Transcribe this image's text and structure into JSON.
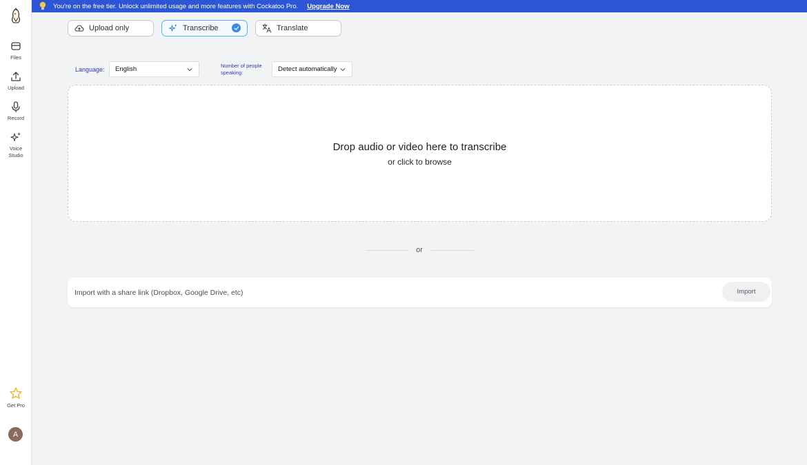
{
  "banner": {
    "icon": "lightbulb-icon",
    "text": "You're on the free tier. Unlock unlimited usage and more features with Cockatoo Pro.",
    "link": "Upgrade Now"
  },
  "sidebar": {
    "logo": "cockatoo-logo",
    "items": [
      {
        "label": "Files",
        "icon": "folder-icon"
      },
      {
        "label": "Upload",
        "icon": "upload-icon"
      },
      {
        "label": "Record",
        "icon": "microphone-icon"
      },
      {
        "label": "Voice Studio",
        "icon": "sparkles-icon"
      }
    ],
    "get_pro": {
      "label": "Get Pro",
      "icon": "star-icon"
    },
    "avatar": "A"
  },
  "modes": [
    {
      "label": "Upload only",
      "icon": "cloud-upload-icon",
      "active": false
    },
    {
      "label": "Transcribe",
      "icon": "sparkles-icon",
      "active": true
    },
    {
      "label": "Translate",
      "icon": "translate-icon",
      "active": false
    }
  ],
  "language": {
    "label": "Language:",
    "value": "English"
  },
  "speakers": {
    "label": "Number of people speaking:",
    "value": "Detect automatically"
  },
  "dropzone": {
    "title": "Drop audio or video here to transcribe",
    "subtitle": "or click to browse"
  },
  "divider": "or",
  "import": {
    "placeholder": "Import with a share link (Dropbox, Google Drive, etc)",
    "button": "Import"
  },
  "colors": {
    "banner": "#2d56d6",
    "accent": "#3d8be0",
    "active_border": "#5ab0e6",
    "label_blue": "#2a3fb0",
    "star": "#f0b429"
  }
}
